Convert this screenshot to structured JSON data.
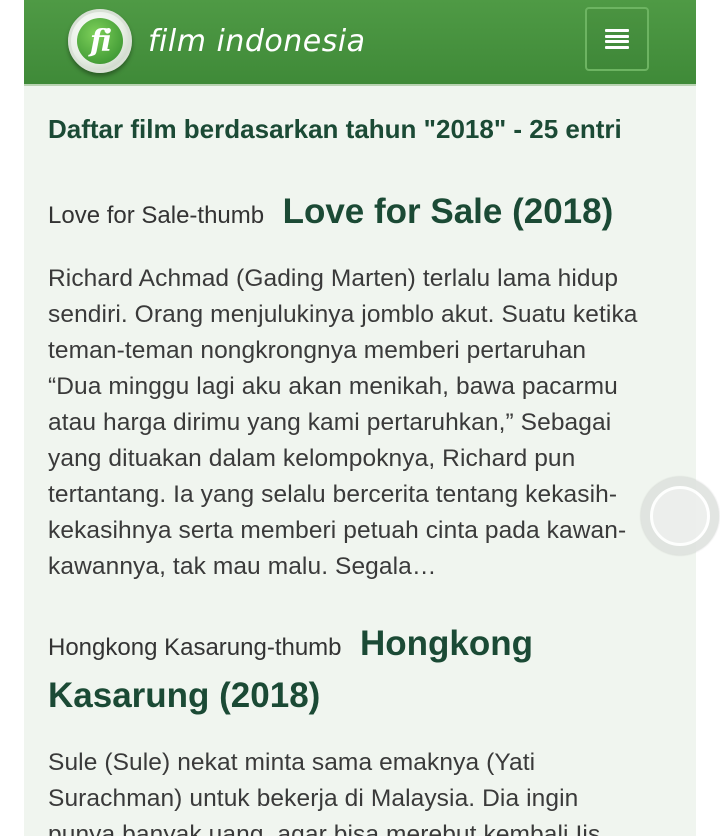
{
  "header": {
    "logo_letters": "fi",
    "site_name": "film indonesia",
    "menu_icon": "hamburger-menu-icon"
  },
  "page_title": "Daftar film berdasarkan tahun \"2018\" - 25 entri",
  "entries": [
    {
      "thumb_alt": "Love for Sale-thumb",
      "title_line1": "Love for Sale (2018)",
      "title_line2": "",
      "lines": [
        "Richard Achmad (Gading Marten) terlalu lama hidup",
        "sendiri. Orang menjulukinya jomblo akut. Suatu ketika",
        "teman-teman nongkrongnya memberi pertaruhan",
        "“Dua minggu lagi aku akan menikah, bawa pacarmu",
        "atau harga dirimu yang kami pertaruhkan,” Sebagai",
        "yang dituakan dalam kelompoknya, Richard pun",
        "tertantang. Ia yang selalu bercerita tentang kekasih-",
        "kekasihnya serta memberi petuah cinta pada kawan-",
        "kawannya, tak mau malu. Segala…"
      ]
    },
    {
      "thumb_alt": "Hongkong Kasarung-thumb",
      "title_line1": "Hongkong",
      "title_line2": "Kasarung (2018)",
      "lines": [
        "Sule (Sule) nekat minta sama emaknya (Yati",
        "Surachman) untuk bekerja di Malaysia. Dia ingin",
        "punya banyak uang, agar bisa merebut kembali Iis"
      ]
    }
  ]
}
